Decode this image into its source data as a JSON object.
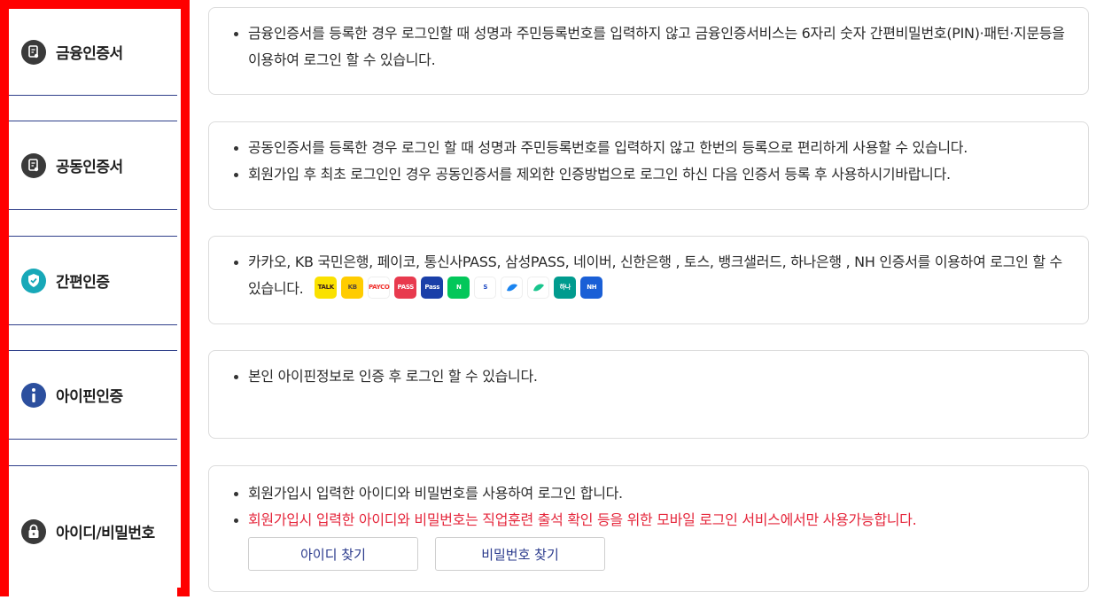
{
  "nav": [
    {
      "label": "금융인증서",
      "icon": "certificate-icon",
      "color": "#3a3a3a"
    },
    {
      "label": "공동인증서",
      "icon": "certificate-icon",
      "color": "#3a3a3a"
    },
    {
      "label": "간편인증",
      "icon": "shield-check-icon",
      "color": "#17a8b8"
    },
    {
      "label": "아이핀인증",
      "icon": "info-icon",
      "color": "#2c4f9e"
    },
    {
      "label": "아이디/비밀번호",
      "icon": "lock-icon",
      "color": "#3a3a3a"
    }
  ],
  "cards": {
    "financial": {
      "lines": [
        "금융인증서를 등록한 경우 로그인할 때 성명과 주민등록번호를 입력하지 않고 금융인증서비스는 6자리 숫자 간편비밀번호(PIN)·패턴·지문등을 이용하여 로그인 할 수 있습니다."
      ]
    },
    "joint": {
      "lines": [
        "공동인증서를 등록한 경우 로그인 할 때 성명과 주민등록번호를 입력하지 않고 한번의 등록으로 편리하게 사용할 수 있습니다.",
        "회원가입 후 최초 로그인인 경우 공동인증서를 제외한 인증방법으로 로그인 하신 다음 인증서 등록 후 사용하시기바랍니다."
      ]
    },
    "simple": {
      "lines": [
        "카카오, KB 국민은행, 페이코, 통신사PASS, 삼성PASS, 네이버, 신한은행 , 토스, 뱅크샐러드, 하나은행 , NH 인증서를 이용하여 로그인 할 수 있습니다."
      ],
      "badges": [
        {
          "name": "kakao-icon",
          "text": "TALK",
          "bg": "#fae100",
          "fg": "#3b1e1e"
        },
        {
          "name": "kb-icon",
          "text": "KB",
          "bg": "#ffcc00",
          "fg": "#5a4a3a"
        },
        {
          "name": "payco-icon",
          "text": "PAYCO",
          "bg": "#ffffff",
          "fg": "#f0302c"
        },
        {
          "name": "pass-icon",
          "text": "PASS",
          "bg": "#e83a4e",
          "fg": "#ffffff"
        },
        {
          "name": "samsung-pass-icon",
          "text": "Pass",
          "bg": "#1a3fa8",
          "fg": "#ffffff"
        },
        {
          "name": "naver-icon",
          "text": "N",
          "bg": "#03c75a",
          "fg": "#ffffff"
        },
        {
          "name": "shinhan-icon",
          "text": "S",
          "bg": "#ffffff",
          "fg": "#1b47c2"
        },
        {
          "name": "toss-icon",
          "text": "",
          "bg": "#ffffff",
          "fg": "#1a84f0"
        },
        {
          "name": "banksalad-icon",
          "text": "",
          "bg": "#ffffff",
          "fg": "#19c58d"
        },
        {
          "name": "hana-icon",
          "text": "하나",
          "bg": "#009b8e",
          "fg": "#ffffff"
        },
        {
          "name": "nh-icon",
          "text": "NH",
          "bg": "#1a5fd6",
          "fg": "#ffffff"
        }
      ]
    },
    "ipin": {
      "lines": [
        "본인 아이핀정보로 인증 후 로그인 할 수 있습니다."
      ]
    },
    "idpw": {
      "lines": [
        "회원가입시 입력한 아이디와 비밀번호를 사용하여 로그인 합니다."
      ],
      "warning": "회원가입시 입력한 아이디와 비밀번호는 직업훈련 출석 확인 등을 위한 모바일 로그인 서비스에서만 사용가능합니다.",
      "find_id_label": "아이디 찾기",
      "find_pw_label": "비밀번호 찾기"
    }
  }
}
